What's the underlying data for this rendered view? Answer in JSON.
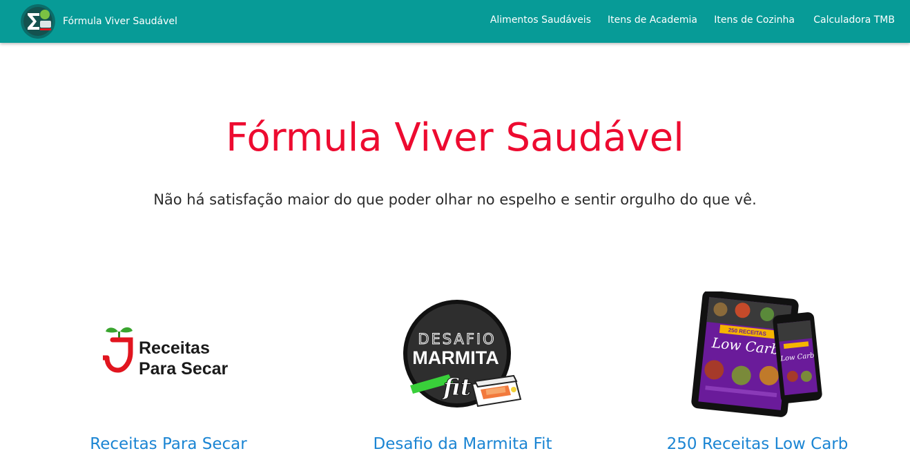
{
  "brand": {
    "name": "Fórmula Viver Saudável",
    "logo_icon": "sigma-logo-icon"
  },
  "nav": {
    "items": [
      {
        "label": "Alimentos Saudáveis"
      },
      {
        "label": "Itens de Academia"
      },
      {
        "label": "Itens de Cozinha"
      },
      {
        "label": "Calculadora TMB"
      }
    ]
  },
  "hero": {
    "title": "Fórmula Viver Saudável",
    "subtitle": "Não há satisfação maior do que poder olhar no espelho e sentir orgulho do que vê."
  },
  "products": [
    {
      "title": "Receitas Para Secar",
      "logo_line1": "Receitas",
      "logo_line2": "Para Secar"
    },
    {
      "title": "Desafio da Marmita Fit",
      "logo_line1": "DESAFIO",
      "logo_line2": "MARMITA",
      "logo_line3": "fit"
    },
    {
      "title": "250 Receitas Low Carb",
      "tablet_badge": "250 RECEITAS",
      "tablet_title": "Low Carb"
    }
  ],
  "colors": {
    "navbar": "#079b97",
    "hero_title": "#ed0b30",
    "link": "#1b85d3",
    "logo_red": "#e1151f",
    "logo_green": "#3aa52f",
    "ebook_purple": "#6a1b9a"
  }
}
